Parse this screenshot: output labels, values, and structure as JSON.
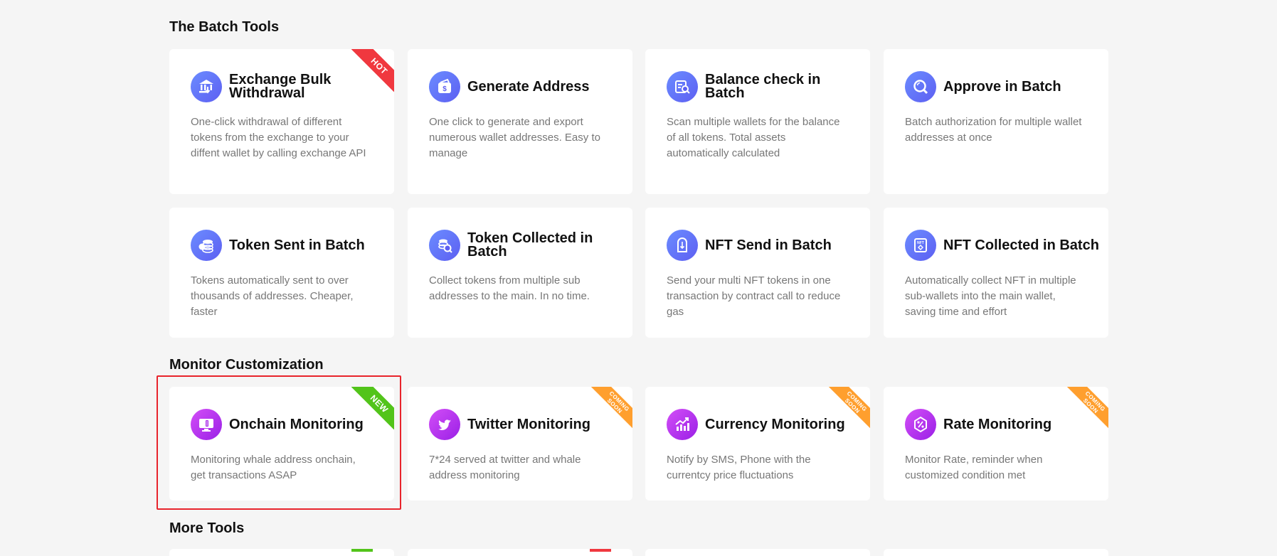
{
  "sections": [
    {
      "title": "The Batch Tools",
      "cards": [
        {
          "title": "Exchange Bulk Withdrawal",
          "desc": "One-click withdrawal of different tokens from the exchange to your diffent wallet by calling exchange API",
          "badge": "HOT",
          "icon": "bank-withdraw-icon"
        },
        {
          "title": "Generate Address",
          "desc": "One click to generate and export numerous wallet addresses. Easy to manage",
          "badge": "",
          "icon": "wallet-dollar-icon"
        },
        {
          "title": "Balance check in Batch",
          "desc": "Scan multiple wallets for the balance of all tokens. Total assets automatically calculated",
          "badge": "",
          "icon": "balance-search-icon"
        },
        {
          "title": "Approve in Batch",
          "desc": "Batch authorization for multiple wallet addresses at once",
          "badge": "",
          "icon": "approve-search-icon"
        },
        {
          "title": "Token Sent in Batch",
          "desc": "Tokens automatically sent to over thousands of addresses. Cheaper, faster",
          "badge": "",
          "icon": "coins-send-icon"
        },
        {
          "title": "Token Collected in Batch",
          "desc": "Collect tokens from multiple sub addresses to the main. In no time.",
          "badge": "",
          "icon": "coins-collect-icon"
        },
        {
          "title": "NFT Send in Batch",
          "desc": "Send your multi NFT tokens in one transaction by contract call to reduce gas",
          "badge": "",
          "icon": "nft-send-icon"
        },
        {
          "title": "NFT Collected in Batch",
          "desc": "Automatically collect NFT in multiple sub-wallets into the main wallet, saving time and effort",
          "badge": "",
          "icon": "nft-collect-icon"
        }
      ]
    },
    {
      "title": "Monitor Customization",
      "cards": [
        {
          "title": "Onchain Monitoring",
          "desc": "Monitoring whale address onchain, get transactions ASAP",
          "badge": "NEW",
          "icon": "monitor-chain-icon"
        },
        {
          "title": "Twitter Monitoring",
          "desc": "7*24 served at twitter and whale address monitoring",
          "badge": "COMING SOON",
          "icon": "twitter-icon"
        },
        {
          "title": "Currency Monitoring",
          "desc": "Notify by SMS, Phone with the currentcy price fluctuations",
          "badge": "COMING SOON",
          "icon": "chart-up-icon"
        },
        {
          "title": "Rate Monitoring",
          "desc": "Monitor Rate, reminder when customized condition met",
          "badge": "COMING SOON",
          "icon": "rate-percent-icon"
        }
      ]
    },
    {
      "title": "More Tools",
      "cards": []
    }
  ],
  "colors": {
    "background": "#f5f5f5",
    "hot": "#f0383f",
    "new": "#52c41a",
    "coming_soon": "#ff9f2e",
    "highlight": "#e8242c"
  }
}
